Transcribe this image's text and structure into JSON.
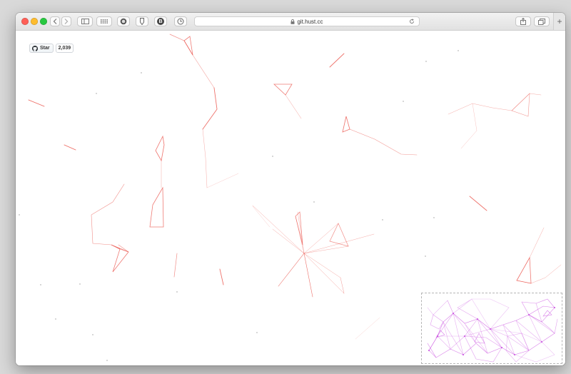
{
  "browser": {
    "address_text": "git.hust.cc",
    "icons": {
      "back": "chevron-left-icon",
      "forward": "chevron-right-icon",
      "sidebar": "sidebar-icon",
      "top_sites": "grid-icon",
      "extension_1": "circle-extension-icon",
      "extension_2": "bookmark-extension-icon",
      "extension_3": "b-extension-icon",
      "extension_4": "clock-extension-icon",
      "secure": "lock-icon",
      "reload": "reload-icon",
      "share": "share-icon",
      "tabs": "tabs-icon",
      "new_tab": "plus-icon"
    },
    "extension_3_letter": "B",
    "new_tab_label": "+"
  },
  "github_widget": {
    "star_label": "Star",
    "star_count": "2,039",
    "icon": "github-icon"
  },
  "colors": {
    "line_main": "#e8433a",
    "minimap_line": "#c94fe0",
    "background": "#ffffff"
  }
}
